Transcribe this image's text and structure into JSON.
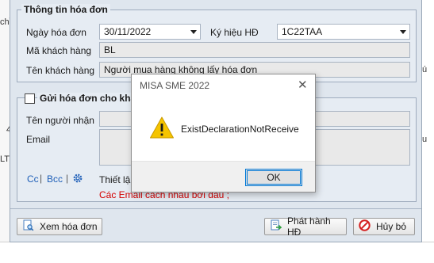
{
  "background": {
    "left_snippets": [
      "chỉ",
      "4",
      "LT"
    ],
    "right_snippets": [
      "ú",
      "u"
    ]
  },
  "invoice_info": {
    "section_title": "Thông tin hóa đơn",
    "invoice_date_label": "Ngày hóa đơn",
    "invoice_date_value": "30/11/2022",
    "symbol_label": "Ký hiệu HĐ",
    "symbol_value": "1C22TAA",
    "customer_code_label": "Mã khách hàng",
    "customer_code_value": "BL",
    "customer_name_label": "Tên khách hàng",
    "customer_name_value": "Người mua hàng không lấy hóa đơn"
  },
  "send_invoice": {
    "section_title": "Gửi hóa đơn cho khác",
    "checked": false,
    "recipient_label": "Tên người nhận",
    "recipient_value": "",
    "email_label": "Email",
    "email_value": "",
    "cc_label": "Cc",
    "separator": "|",
    "bcc_label": "Bcc",
    "settings_prefix": "Thiết lậ",
    "email_hint": "Các Email cách nhau bởi dấu ;"
  },
  "buttons": {
    "view_invoice": "Xem hóa đơn",
    "issue": "Phát hành HĐ",
    "cancel": "Hủy bỏ"
  },
  "dialog": {
    "title": "MISA SME 2022",
    "message": "ExistDeclarationNotReceive",
    "ok_label": "OK",
    "close_glyph": "✕"
  },
  "colors": {
    "accent": "#0078d7",
    "warning_icon": "#f5c400",
    "hint_text": "#d40000",
    "link": "#1f5fb8"
  }
}
